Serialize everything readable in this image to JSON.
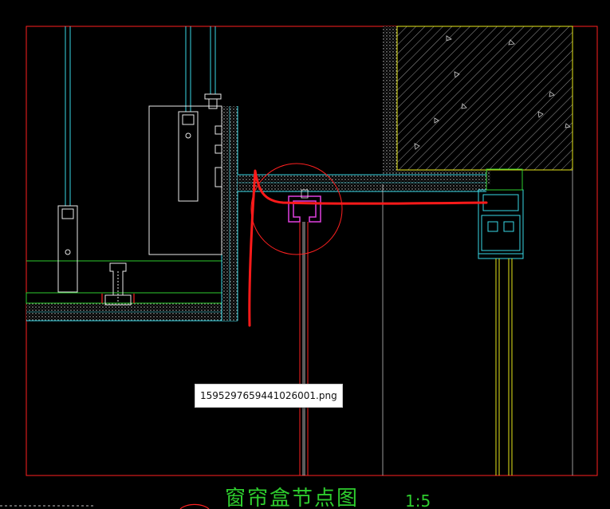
{
  "tooltip": {
    "filename": "1595297659441026001.png"
  },
  "drawing": {
    "title": "窗帘盒节点图",
    "scale": "1:5"
  },
  "colors": {
    "background": "#000000",
    "frame": "#ff2020",
    "cyan": "#39d9e6",
    "green": "#2ecc2e",
    "yellow": "#e6e61a",
    "magenta": "#e040e0",
    "white": "#e8e8e8",
    "red_markup": "#ff1a1a"
  }
}
